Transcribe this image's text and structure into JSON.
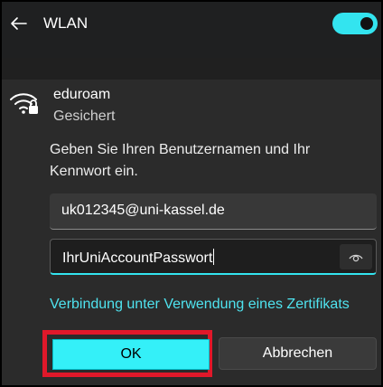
{
  "header": {
    "title": "WLAN",
    "toggle_state": "on"
  },
  "network": {
    "name": "eduroam",
    "status": "Gesichert",
    "prompt": "Geben Sie Ihren Benutzernamen und Ihr Kennwort ein.",
    "username_value": "uk012345@uni-kassel.de",
    "password_value": "IhrUniAccountPasswort",
    "certificate_link": "Verbindung unter Verwendung eines Zertifikats"
  },
  "buttons": {
    "ok_label": "OK",
    "cancel_label": "Abbrechen"
  },
  "colors": {
    "accent": "#33e4ef",
    "highlight": "#e0182a"
  },
  "icons": [
    "back-arrow-icon",
    "wifi-secured-icon",
    "reveal-password-icon"
  ]
}
